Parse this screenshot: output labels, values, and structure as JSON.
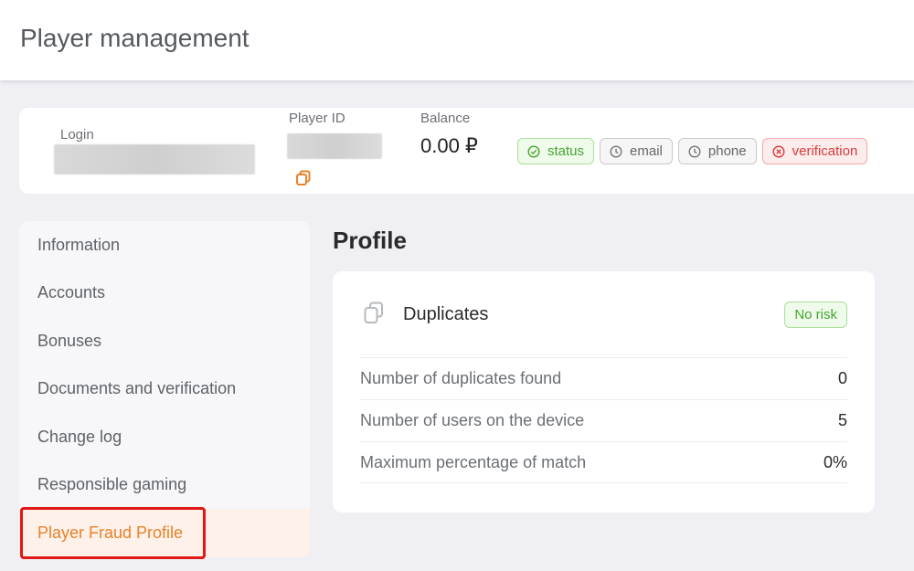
{
  "header": {
    "title": "Player management"
  },
  "player": {
    "login_label": "Login",
    "player_id_label": "Player ID",
    "balance_label": "Balance",
    "balance_value": "0.00 ₽"
  },
  "badges": [
    {
      "label": "status",
      "state": "ok",
      "icon": "check-circle-icon"
    },
    {
      "label": "email",
      "state": "pending",
      "icon": "clock-icon"
    },
    {
      "label": "phone",
      "state": "pending",
      "icon": "clock-icon"
    },
    {
      "label": "verification",
      "state": "error",
      "icon": "x-circle-icon"
    }
  ],
  "sidebar": {
    "items": [
      {
        "label": "Information"
      },
      {
        "label": "Accounts"
      },
      {
        "label": "Bonuses"
      },
      {
        "label": "Documents and verification"
      },
      {
        "label": "Change log"
      },
      {
        "label": "Responsible gaming"
      },
      {
        "label": "Player Fraud Profile",
        "active": true
      }
    ]
  },
  "main": {
    "title": "Profile",
    "duplicates": {
      "title": "Duplicates",
      "risk": "No risk",
      "rows": [
        {
          "label": "Number of duplicates found",
          "value": "0"
        },
        {
          "label": "Number of users on the device",
          "value": "5"
        },
        {
          "label": "Maximum percentage of match",
          "value": "0%"
        }
      ]
    }
  },
  "colors": {
    "accent": "#e8822a",
    "ok": "#4aa334",
    "error": "#d83b3b",
    "highlight": "#e01818"
  }
}
